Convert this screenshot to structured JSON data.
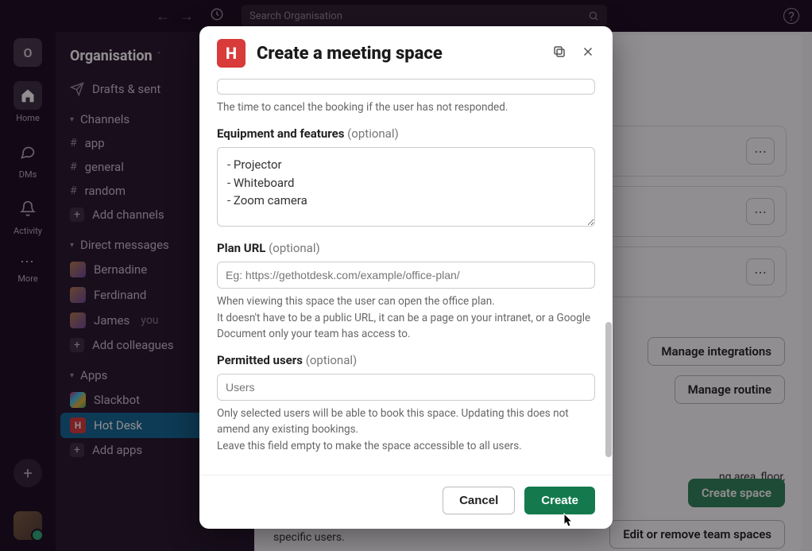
{
  "topbar": {
    "search_placeholder": "Search Organisation"
  },
  "rail": {
    "org_letter": "O",
    "items": [
      {
        "label": "Home",
        "icon": "🏠"
      },
      {
        "label": "DMs",
        "icon": "💬"
      },
      {
        "label": "Activity",
        "icon": "🔔"
      },
      {
        "label": "More",
        "icon": "⋯"
      }
    ]
  },
  "sidebar": {
    "org_name": "Organisation",
    "drafts_label": "Drafts & sent",
    "channels_label": "Channels",
    "channels": [
      "app",
      "general",
      "random"
    ],
    "add_channels": "Add channels",
    "dms_label": "Direct messages",
    "dms": [
      {
        "name": "Bernadine"
      },
      {
        "name": "Ferdinand"
      },
      {
        "name": "James",
        "you": "you"
      }
    ],
    "add_colleagues": "Add colleagues",
    "apps_label": "Apps",
    "apps": [
      {
        "name": "Slackbot",
        "cls": "slackbot"
      },
      {
        "name": "Hot Desk",
        "cls": "hotdesk"
      }
    ],
    "add_apps": "Add apps"
  },
  "main": {
    "manage_integrations": "Manage integrations",
    "manage_routine": "Manage routine",
    "create_space": "Create space",
    "edit_spaces": "Edit or remove team spaces",
    "bg_text1": "ng area, floor,",
    "bg_text2": "specific users."
  },
  "modal": {
    "title": "Create a meeting space",
    "timehelper": "The time to cancel the booking if the user has not responded.",
    "equip_label": "Equipment and features",
    "optional": "(optional)",
    "equip_value": "- Projector\n- Whiteboard\n- Zoom camera",
    "plan_label": "Plan URL",
    "plan_placeholder": "Eg: https://gethotdesk.com/example/office-plan/",
    "plan_helper": "When viewing this space the user can open the office plan.\nIt doesn't have to be a public URL, it can be a page on your intranet, or a Google Document only your team has access to.",
    "users_label": "Permitted users",
    "users_placeholder": "Users",
    "users_helper": "Only selected users will be able to book this space. Updating this does not amend any existing bookings.\nLeave this field empty to make the space accessible to all users.",
    "cancel": "Cancel",
    "create": "Create"
  }
}
